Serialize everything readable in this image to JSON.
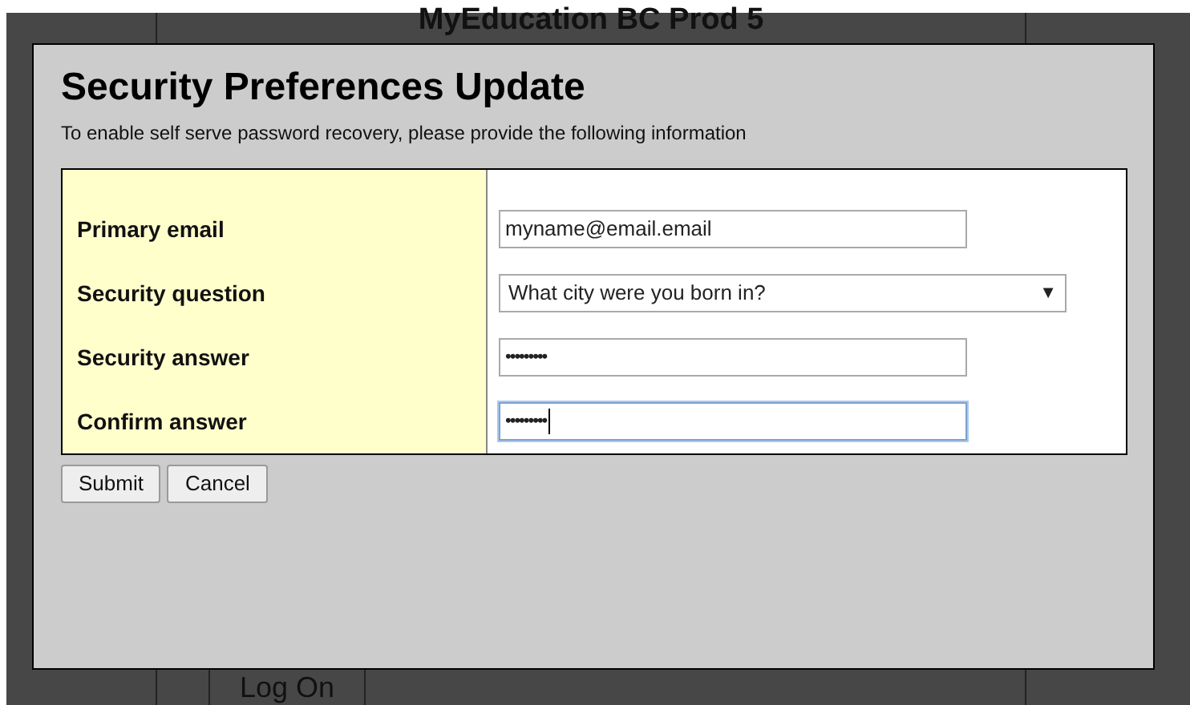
{
  "page_title": "MyEducation BC Prod 5",
  "dialog": {
    "title": "Security Preferences Update",
    "subtitle": "To enable self serve password recovery, please provide the following information",
    "fields": [
      {
        "label": "Primary email",
        "kind": "text",
        "value": "myname@email.email",
        "focused": false
      },
      {
        "label": "Security question",
        "kind": "select",
        "value": "What city were you born in?",
        "arrow": "▼",
        "focused": false
      },
      {
        "label": "Security answer",
        "kind": "password",
        "value": "•••••••••",
        "focused": false
      },
      {
        "label": "Confirm answer",
        "kind": "password",
        "value": "•••••••••",
        "focused": true
      }
    ],
    "buttons": [
      "Submit",
      "Cancel"
    ]
  },
  "log_on_button": "Log On"
}
